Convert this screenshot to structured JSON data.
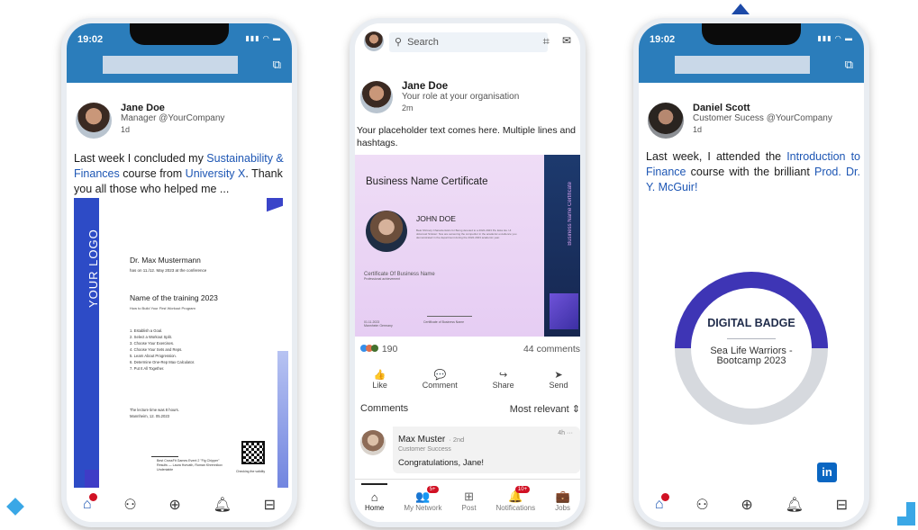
{
  "phone1": {
    "time": "19:02",
    "status_icons": "▮▮▮ ◠ ▬",
    "author": {
      "name": "Jane Doe",
      "role": "Manager @YourCompany",
      "ago": "1d"
    },
    "post": {
      "text_a": "Last week I concluded my ",
      "link_a": "Sustainability & Finances",
      "text_b": " course from ",
      "link_b": "University X",
      "text_c": ". Thank you all those who helped me ..."
    },
    "certificate": {
      "logo": "YOUR LOGO",
      "name": "Dr. Max Mustermann",
      "has_on": "has on 11./12. May 2023 at the conference",
      "training": "Name of the training 2023",
      "how_to": "How to Build Your First Workout Program",
      "steps": [
        "1. Establish a Goal.",
        "2. Select a Workout Split.",
        "3. Choose Your Exercises.",
        "4. Choose Your Sets and Reps.",
        "5. Learn About Progression.",
        "6. Determine One-Rep Max Calculator.",
        "7. Put It All Together."
      ],
      "lecture": "The lecture time was 8 hours.",
      "place_date": "Mannheim, 12. 05.2023",
      "signature_caption": "Best CrossFit Games Event 2 \"Fig Chipper\" Results — Laura Horvath, Roman Khrennikov Undeniable",
      "check_validity": "Checking the validity"
    }
  },
  "phone2": {
    "search_placeholder": "Search",
    "author": {
      "name": "Jane Doe",
      "role": "Your role at your organisation",
      "ago": "2m"
    },
    "post_text": "Your placeholder text comes here. Multiple lines and hashtags.",
    "certificate": {
      "title": "Business Name Certificate",
      "side_text": "Business Name Certificate",
      "recipient": "JOHN DOE",
      "fine_print": "Beat Shrinely Characteristics for Being devoted to a 2022-2023 Pa. Esta Ha. Ut dolorosa! Sinister: Nos are seinening the competitor in the academic excellence you demonstrated in the department during the 2022-2023 academic year.",
      "cert_of": "Certificate Of Business Name",
      "cert_sub": "Professional achievement",
      "sig_left": "01.11.2023\nMannheim Germany",
      "sig_right": "Certificate of Business Name"
    },
    "reactions": {
      "count": "190",
      "comments": "44 comments"
    },
    "actions": [
      {
        "icon": "👍",
        "label": "Like"
      },
      {
        "icon": "💬",
        "label": "Comment"
      },
      {
        "icon": "↪",
        "label": "Share"
      },
      {
        "icon": "➤",
        "label": "Send"
      }
    ],
    "comments_label": "Comments",
    "sort_label": "Most relevant",
    "comment": {
      "name": "Max Muster",
      "degree": "· 2nd",
      "role": "Customer Success",
      "ago": "4h ···",
      "text": "Congratulations, Jane!"
    },
    "nav": [
      {
        "icon": "⌂",
        "label": "Home",
        "badge": ""
      },
      {
        "icon": "👥",
        "label": "My Network",
        "badge": "5+"
      },
      {
        "icon": "⊞",
        "label": "Post",
        "badge": ""
      },
      {
        "icon": "🔔",
        "label": "Notifications",
        "badge": "10+"
      },
      {
        "icon": "💼",
        "label": "Jobs",
        "badge": ""
      }
    ]
  },
  "phone3": {
    "time": "19:02",
    "status_icons": "▮▮▮ ◠ ▬",
    "author": {
      "name": "Daniel Scott",
      "role": "Customer Sucess @YourCompany",
      "ago": "1d"
    },
    "post": {
      "text_a": "Last week, I attended the ",
      "link_a": "Introduction to Finance",
      "text_b": " course with the brilliant ",
      "link_b": "Prod. Dr. Y. McGuir!"
    },
    "badge": {
      "title": "DIGITAL BADGE",
      "sub": "Sea Life Warriors - Bootcamp 2023"
    },
    "linkedin_logo": "in"
  },
  "colors": {
    "header_blue": "#2b7dbb",
    "link_blue": "#1d56b4",
    "badge_purple": "#3e35b5",
    "accent_cyan": "#3aa7e6"
  }
}
